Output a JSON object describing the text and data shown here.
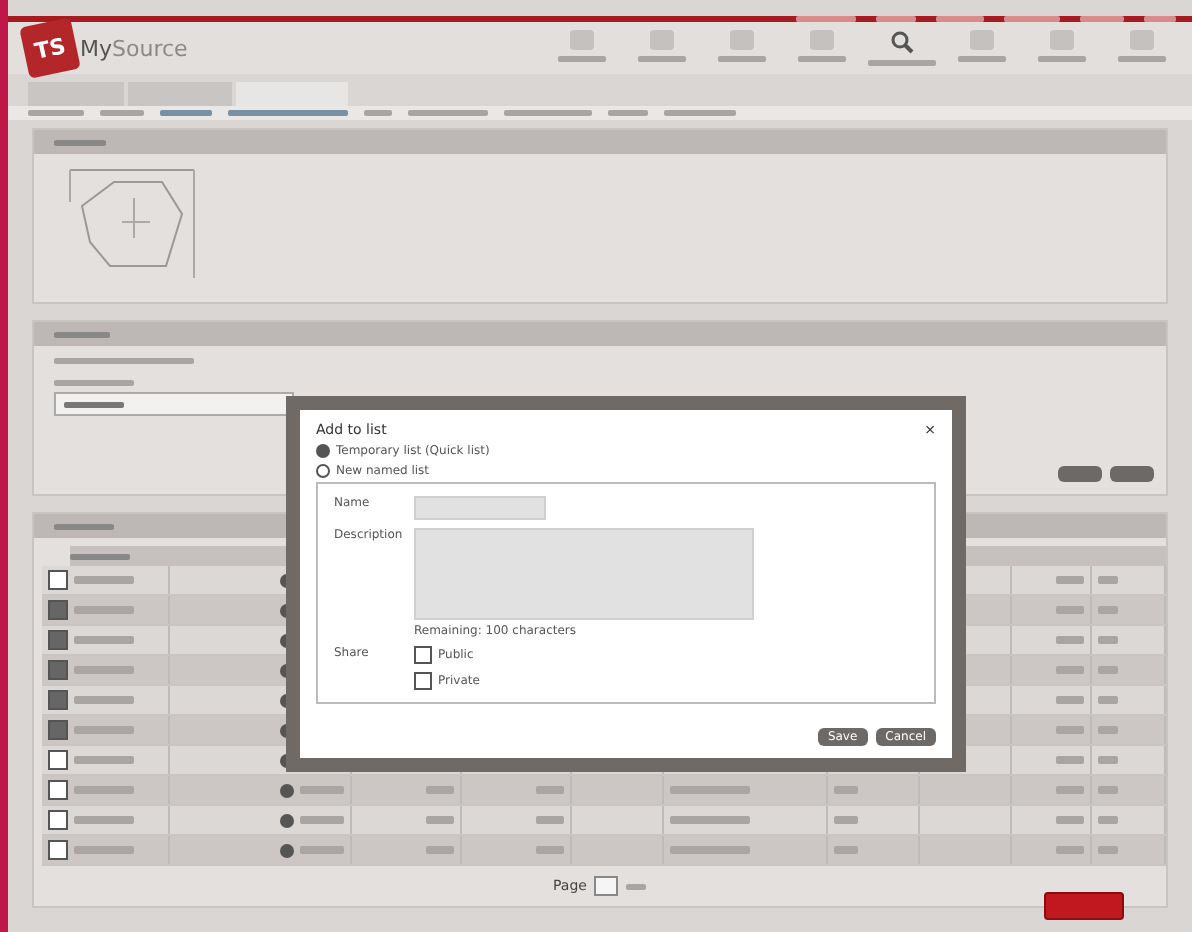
{
  "logo": {
    "badge": "TS",
    "prefix": "My",
    "suffix": "Source"
  },
  "dialog": {
    "title": "Add to list",
    "close": "×",
    "options": [
      {
        "label": "Temporary list (Quick list)",
        "selected": true
      },
      {
        "label": "New named list",
        "selected": false
      }
    ],
    "name_label": "Name",
    "description_label": "Description",
    "remaining": "Remaining: 100 characters",
    "share_label": "Share",
    "share_options": [
      {
        "label": "Public",
        "checked": false
      },
      {
        "label": "Private",
        "checked": false
      }
    ],
    "buttons": [
      "Save",
      "Cancel"
    ]
  },
  "results": {
    "rows": [
      {
        "checked": false
      },
      {
        "checked": true
      },
      {
        "checked": true
      },
      {
        "checked": true
      },
      {
        "checked": true
      },
      {
        "checked": true
      },
      {
        "checked": false
      },
      {
        "checked": false
      },
      {
        "checked": false
      },
      {
        "checked": false
      }
    ]
  },
  "pager": {
    "label": "Page"
  },
  "tabs": [
    {
      "selected": false
    },
    {
      "selected": false
    },
    {
      "selected": true
    }
  ]
}
